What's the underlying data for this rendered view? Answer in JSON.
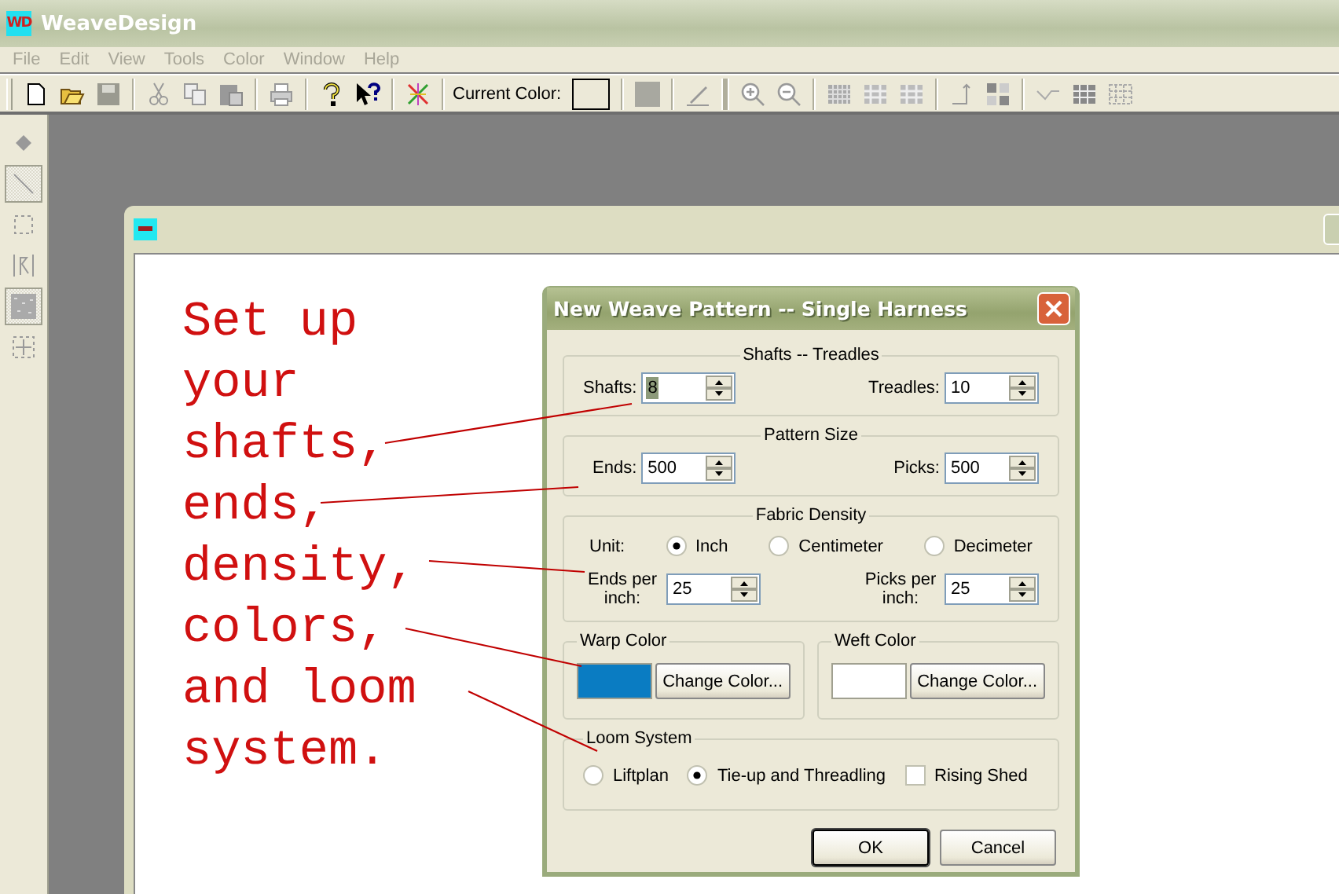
{
  "app": {
    "icon_text": "WD",
    "title": "WeaveDesign"
  },
  "menu": [
    "File",
    "Edit",
    "View",
    "Tools",
    "Color",
    "Window",
    "Help"
  ],
  "toolbar": {
    "current_color_label": "Current Color:"
  },
  "tools": [
    {
      "selected": false
    },
    {
      "selected": true
    },
    {
      "selected": false
    },
    {
      "selected": false
    },
    {
      "selected": true
    },
    {
      "selected": false
    }
  ],
  "annotation": [
    "Set up",
    "your",
    "shafts,",
    "ends,",
    "density,",
    "colors,",
    "and loom",
    "system."
  ],
  "dialog": {
    "title": "New Weave Pattern -- Single Harness",
    "shafts_treadles": {
      "title": "Shafts -- Treadles",
      "fields": [
        {
          "label": "Shafts:",
          "value": "8",
          "highlighted": true
        },
        {
          "label": "Treadles:",
          "value": "10",
          "highlighted": false
        }
      ]
    },
    "pattern_size": {
      "title": "Pattern Size",
      "fields": [
        {
          "label": "Ends:",
          "value": "500",
          "highlighted": false
        },
        {
          "label": "Picks:",
          "value": "500",
          "highlighted": false
        }
      ]
    },
    "fabric_density": {
      "title": "Fabric Density",
      "unit_label": "Unit:",
      "units": [
        {
          "label": "Inch",
          "selected": true
        },
        {
          "label": "Centimeter",
          "selected": false
        },
        {
          "label": "Decimeter",
          "selected": false
        }
      ],
      "fields": [
        {
          "label": "Ends per inch:",
          "value": "25",
          "highlighted": false
        },
        {
          "label": "Picks per inch:",
          "value": "25",
          "highlighted": false
        }
      ]
    },
    "warp_color": {
      "title": "Warp Color",
      "color": "#0a7cc2",
      "button": "Change Color..."
    },
    "weft_color": {
      "title": "Weft Color",
      "color": "#ffffff",
      "button": "Change Color..."
    },
    "loom_system": {
      "title": "Loom System",
      "options": [
        {
          "label": "Liftplan",
          "selected": false
        },
        {
          "label": "Tie-up and Threadling",
          "selected": true
        }
      ],
      "rising_shed": {
        "label": "Rising Shed",
        "checked": false
      }
    },
    "buttons": [
      "OK",
      "Cancel"
    ]
  }
}
